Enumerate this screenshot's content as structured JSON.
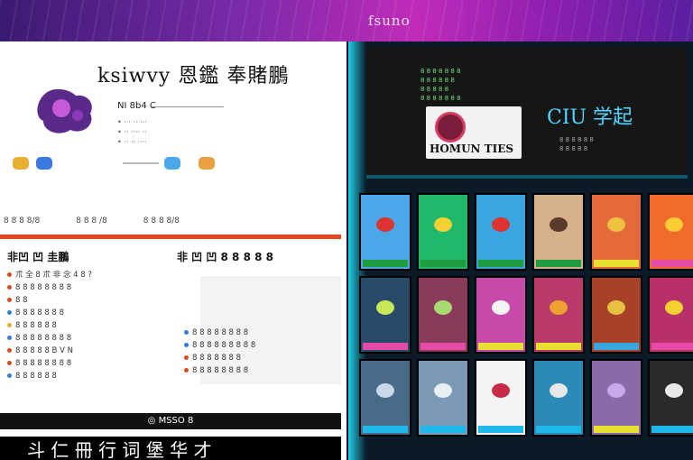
{
  "banner": {
    "text": "fsuno"
  },
  "left": {
    "headline": "ksiwvy 恩鑑 奉賭鵬",
    "sub_label": "NI 8b4 C",
    "bullets": [
      "• ··· ·· ···",
      "• ·· ···· ··",
      "• ·· ·· ····"
    ],
    "meta": [
      "8 8 8 8/8",
      "8 8 8 /8",
      "8 8 8 8/8"
    ],
    "col1_title": "非凹 凹 圭鵬",
    "col1_items": [
      "朮 全 8 朮 非 念 4 8 ?",
      "8 8 8 8 8 8 8 8",
      "8 8",
      "8 8 8 8 8 8 8",
      "8 8 8 8 8 8",
      "8 8 8 8 8 8 8 8",
      "8 8 8 8 8 B V N",
      "8 8 8 8 8 8 8 8",
      "8 8 8 8 8 8"
    ],
    "col2_title": "非 凹 凹 8 8 8 8 8",
    "col2_items": [
      "8 8 8 8 8 8 8 8",
      "8 8 8 8 8 8 8 8 8",
      "8 8 8 8 8 8 8",
      "8 8 8 8 8 8 8 8"
    ],
    "footer": "◎ MSSO 8",
    "big_strip": "斗 仁 冊 行 词 堡 华 才"
  },
  "right": {
    "screen_lines": [
      "8 8 8 8 8 8 8",
      "8 8 8 8 8 8",
      "8 8 8 8 8",
      "8 8 8 8 8 8 8"
    ],
    "emblem_text": "HOMUN TIES",
    "logo": "CIU 学起",
    "screen_sub": [
      "8 8 8 8 8 8",
      "8 8 8 8 8"
    ],
    "tiles": [
      {
        "bg": "#4aa8e8",
        "cap": "#1e9e3e",
        "mark": "#d33"
      },
      {
        "bg": "#1fb86a",
        "cap": "#1e9e3e",
        "mark": "#f4d030"
      },
      {
        "bg": "#3aa6e0",
        "cap": "#1e9e3e",
        "mark": "#d33"
      },
      {
        "bg": "#d7b18a",
        "cap": "#1e9e3e",
        "mark": "#5a3a2a"
      },
      {
        "bg": "#e46a3a",
        "cap": "#e8e030",
        "mark": "#f0c040"
      },
      {
        "bg": "#f06a2a",
        "cap": "#e84aa8",
        "mark": "#ffcc33"
      },
      {
        "bg": "#2a4a6a",
        "cap": "#e84aa8",
        "mark": "#c8e85a"
      },
      {
        "bg": "#8a3a5a",
        "cap": "#e84aa8",
        "mark": "#a8d870"
      },
      {
        "bg": "#c84aa8",
        "cap": "#e8e030",
        "mark": "#f4f4f4"
      },
      {
        "bg": "#b83a6a",
        "cap": "#e8e030",
        "mark": "#f0a030"
      },
      {
        "bg": "#a8402a",
        "cap": "#3aa6e0",
        "mark": "#e8c040"
      },
      {
        "bg": "#b8306a",
        "cap": "#e84aa8",
        "mark": "#f4d030"
      },
      {
        "bg": "#4a6a8a",
        "cap": "#1fb8e8",
        "mark": "#c8d8e8"
      },
      {
        "bg": "#7a9ab8",
        "cap": "#1fb8e8",
        "mark": "#e8f0f4"
      },
      {
        "bg": "#f4f4f4",
        "cap": "#1fb8e8",
        "mark": "#c82a4a"
      },
      {
        "bg": "#2a8ab8",
        "cap": "#1fb8e8",
        "mark": "#e8e8e8"
      },
      {
        "bg": "#8a6aa8",
        "cap": "#e8e030",
        "mark": "#c8a8e8"
      },
      {
        "bg": "#2a2a2a",
        "cap": "#1fb8e8",
        "mark": "#e8e8e8"
      }
    ]
  }
}
